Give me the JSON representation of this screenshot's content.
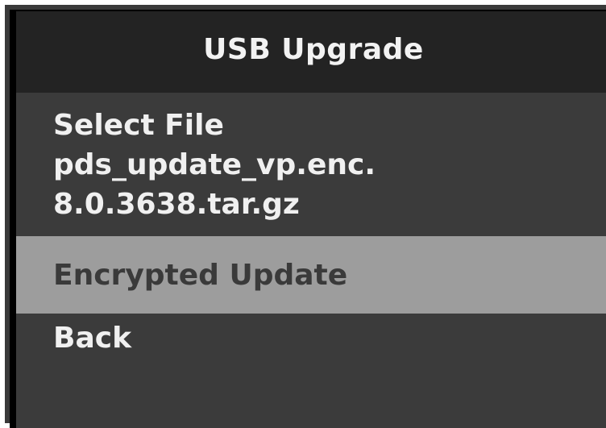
{
  "header": {
    "title": "USB Upgrade"
  },
  "menu": {
    "items": [
      {
        "lines": [
          "Select File",
          "pds_update_vp.enc.",
          "8.0.3638.tar.gz"
        ],
        "selected": false
      },
      {
        "label": "Encrypted Update",
        "selected": true
      },
      {
        "label": "Back",
        "selected": false
      }
    ]
  },
  "colors": {
    "header_bg": "#232323",
    "menu_bg": "#3b3b3b",
    "selected_bg": "#9d9d9d",
    "text_light": "#f0f0f0",
    "text_selected": "#3a3a3a"
  }
}
